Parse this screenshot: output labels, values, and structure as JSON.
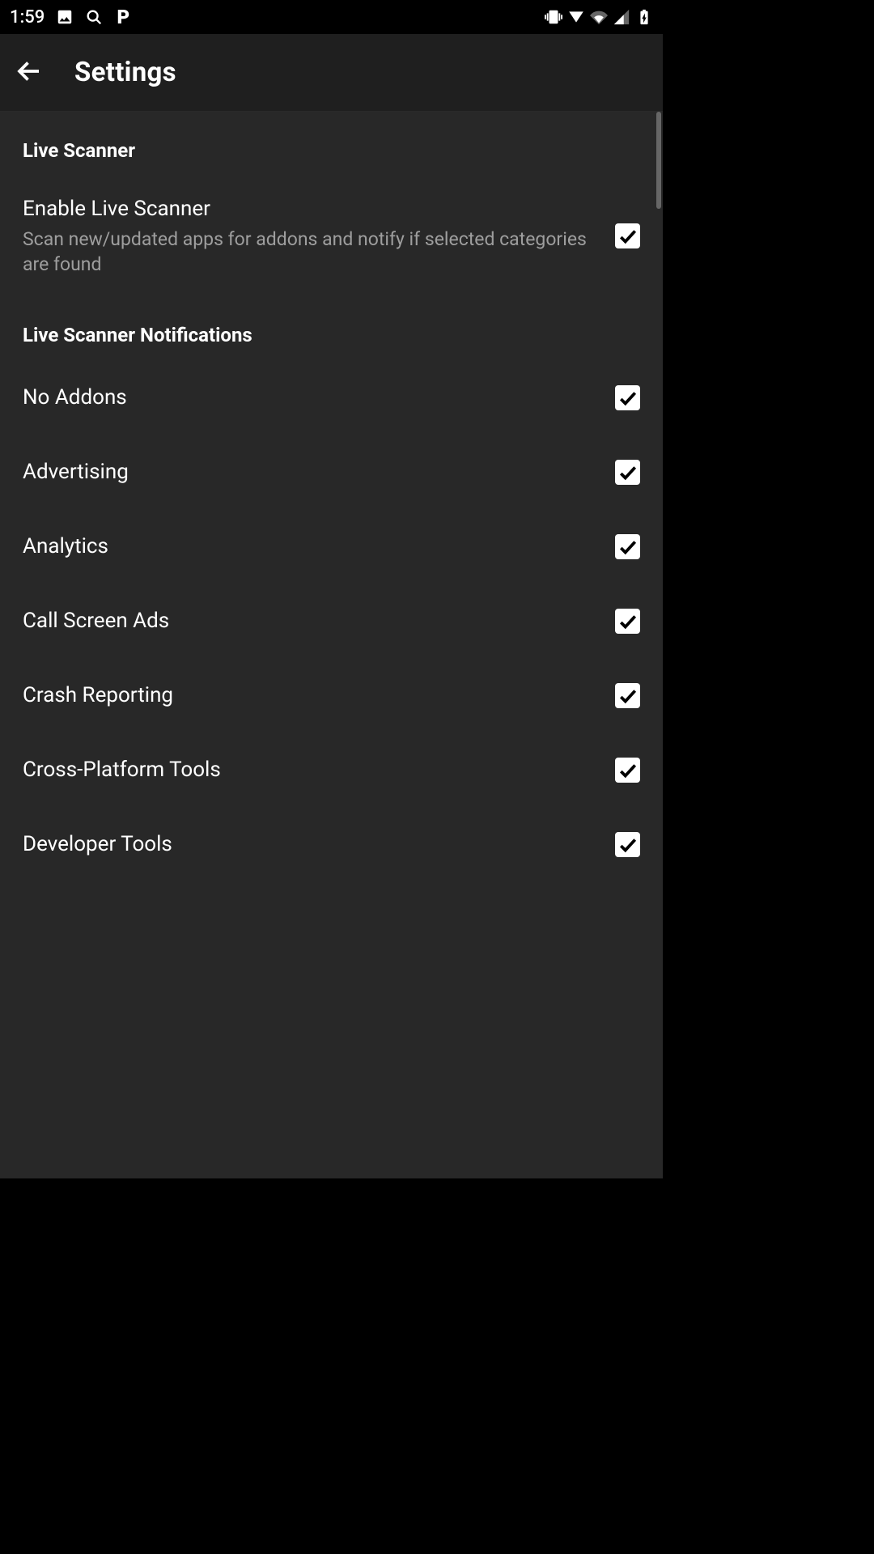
{
  "status": {
    "time": "1:59"
  },
  "appBar": {
    "title": "Settings"
  },
  "sections": {
    "liveScanner": {
      "header": "Live Scanner",
      "enable": {
        "title": "Enable Live Scanner",
        "sub": "Scan new/updated apps for addons and notify if selected categories are found"
      }
    },
    "notifications": {
      "header": "Live Scanner Notifications",
      "items": [
        {
          "label": "No Addons"
        },
        {
          "label": "Advertising"
        },
        {
          "label": "Analytics"
        },
        {
          "label": "Call Screen Ads"
        },
        {
          "label": "Crash Reporting"
        },
        {
          "label": "Cross-Platform Tools"
        },
        {
          "label": "Developer Tools"
        }
      ]
    }
  }
}
